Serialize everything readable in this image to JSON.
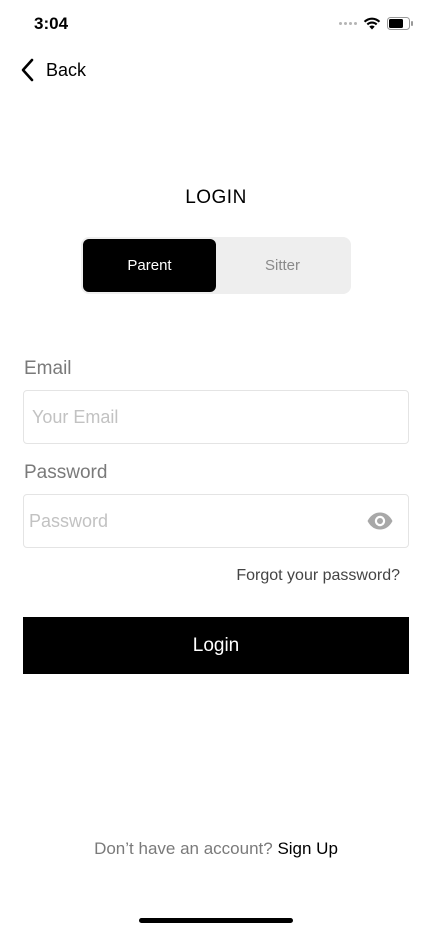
{
  "status_bar": {
    "time": "3:04"
  },
  "nav": {
    "back_label": "Back"
  },
  "title": "LOGIN",
  "role_toggle": {
    "options": [
      "Parent",
      "Sitter"
    ],
    "selected": "Parent"
  },
  "form": {
    "email": {
      "label": "Email",
      "placeholder": "Your Email",
      "value": ""
    },
    "password": {
      "label": "Password",
      "placeholder": "Password",
      "value": ""
    },
    "forgot_password": "Forgot your password?"
  },
  "login_button": "Login",
  "signup": {
    "prompt": "Don’t have an account?",
    "link": "Sign Up"
  },
  "icons": {
    "back": "chevron-left-icon",
    "password_visibility": "eye-icon",
    "wifi": "wifi-icon",
    "battery": "battery-icon",
    "signal": "signal-icon"
  }
}
